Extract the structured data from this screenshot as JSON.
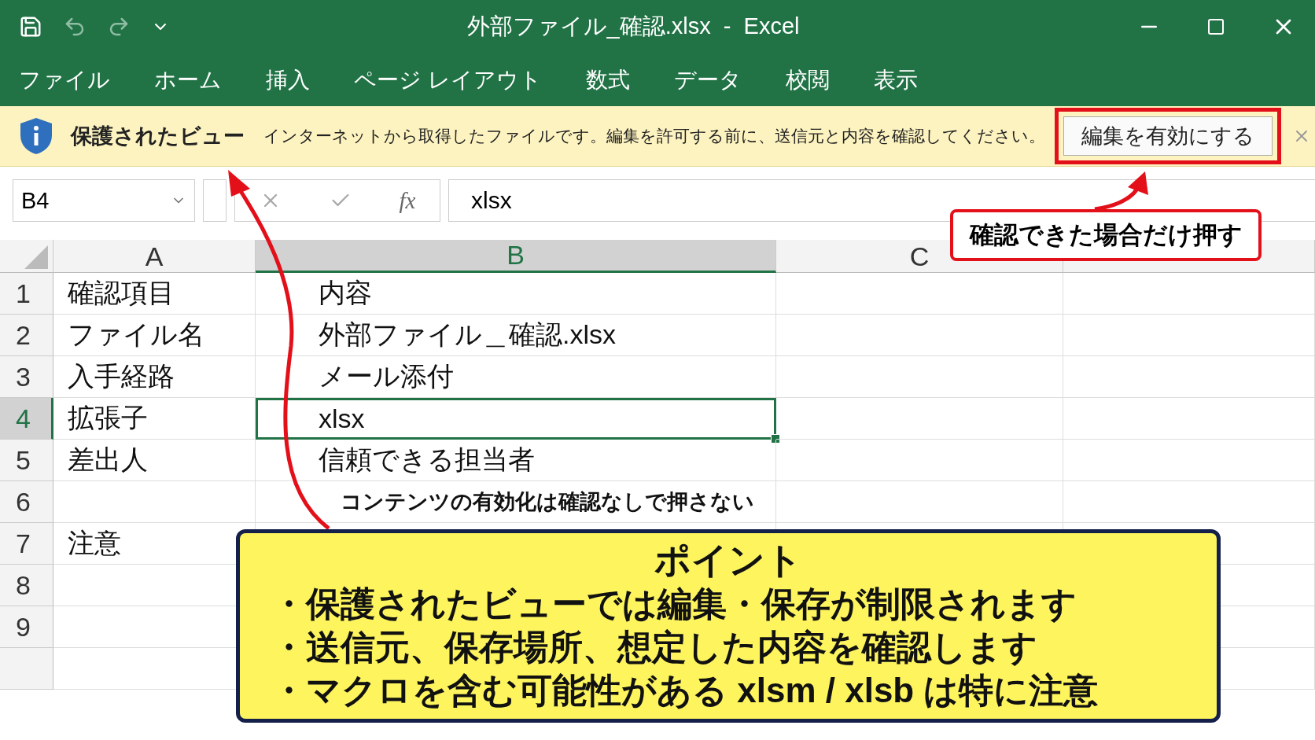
{
  "window": {
    "title": "外部ファイル_確認.xlsx  -  Excel"
  },
  "ribbon_tabs": [
    {
      "label": "ファイル"
    },
    {
      "label": "ホーム"
    },
    {
      "label": "挿入"
    },
    {
      "label": "ページ レイアウト"
    },
    {
      "label": "数式"
    },
    {
      "label": "データ"
    },
    {
      "label": "校閲"
    },
    {
      "label": "表示"
    }
  ],
  "protected_view": {
    "title": "保護されたビュー",
    "message": "インターネットから取得したファイルです。編集を許可する前に、送信元と内容を確認してください。",
    "button": "編集を有効にする",
    "button_highlighted": true
  },
  "formula_bar": {
    "name_box": "B4",
    "function_label": "fx",
    "value": "xlsx"
  },
  "columns": [
    {
      "label": "A",
      "selected": false
    },
    {
      "label": "B",
      "selected": true
    },
    {
      "label": "C",
      "selected": false
    }
  ],
  "rows": [
    {
      "number": "1",
      "selected": false,
      "cells": [
        {
          "kind": "value",
          "text": "確認項目",
          "selected": false
        },
        {
          "kind": "value",
          "text": "内容",
          "selected": false
        }
      ]
    },
    {
      "number": "2",
      "selected": false,
      "cells": [
        {
          "kind": "value",
          "text": "ファイル名",
          "selected": false
        },
        {
          "kind": "value",
          "text": "外部ファイル＿確認.xlsx",
          "selected": false
        }
      ]
    },
    {
      "number": "3",
      "selected": false,
      "cells": [
        {
          "kind": "value",
          "text": "入手経路",
          "selected": false
        },
        {
          "kind": "value",
          "text": "メール添付",
          "selected": false
        }
      ]
    },
    {
      "number": "4",
      "selected": true,
      "cells": [
        {
          "kind": "value",
          "text": "拡張子",
          "selected": false
        },
        {
          "kind": "value",
          "text": "xlsx",
          "selected": true
        }
      ]
    },
    {
      "number": "5",
      "selected": false,
      "cells": [
        {
          "kind": "value",
          "text": "差出人",
          "selected": false
        },
        {
          "kind": "value",
          "text": "信頼できる担当者",
          "selected": false
        }
      ]
    },
    {
      "number": "6",
      "selected": false,
      "cells": [
        {
          "kind": "value",
          "selected": false
        },
        {
          "kind": "note",
          "text": "コンテンツの有効化は確認なしで押さない",
          "selected": false
        }
      ]
    },
    {
      "number": "7",
      "selected": false,
      "cells": [
        {
          "kind": "value",
          "text": "注意",
          "selected": false
        }
      ]
    },
    {
      "number": "8",
      "selected": false
    },
    {
      "number": "9",
      "selected": false
    }
  ],
  "callout_label": {
    "text": "確認できた場合だけ押す"
  },
  "point_box": {
    "title": "ポイント",
    "bullets": [
      "・保護されたビューでは編集・保存が制限されます",
      "・送信元、保存場所、想定した内容を確認します",
      "・マクロを含む可能性がある xlsm / xlsb は特に注意"
    ]
  }
}
